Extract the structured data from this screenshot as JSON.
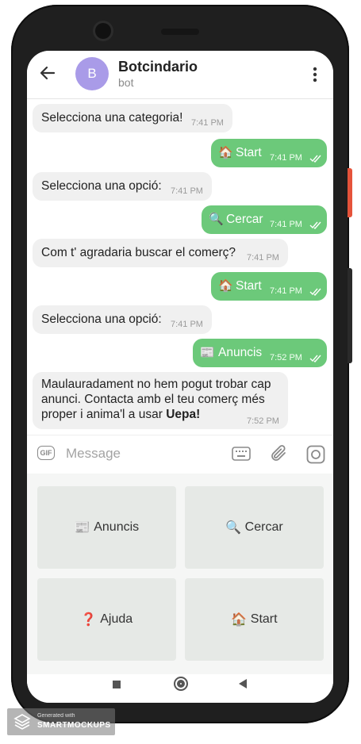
{
  "header": {
    "back_icon": "arrow-left-icon",
    "avatar_letter": "B",
    "avatar_color": "#a99be8",
    "title": "Botcindario",
    "subtitle": "bot",
    "menu_icon": "more-vertical-icon"
  },
  "messages": [
    {
      "dir": "in",
      "text": "Selecciona una categoria!",
      "time": "7:41 PM"
    },
    {
      "dir": "out",
      "emoji": "🏠",
      "text": "Start",
      "time": "7:41 PM"
    },
    {
      "dir": "in",
      "text": "Selecciona una opció:",
      "time": "7:41 PM"
    },
    {
      "dir": "out",
      "emoji": "🔍",
      "text": "Cercar",
      "time": "7:41 PM"
    },
    {
      "dir": "in",
      "text": "Com t' agradaria buscar el comerç?",
      "time": "7:41 PM"
    },
    {
      "dir": "out",
      "emoji": "🏠",
      "text": "Start",
      "time": "7:41 PM"
    },
    {
      "dir": "in",
      "text": "Selecciona una opció:",
      "time": "7:41 PM"
    },
    {
      "dir": "out",
      "emoji": "📰",
      "text": "Anuncis",
      "time": "7:52 PM"
    },
    {
      "dir": "in",
      "line1": "Maulauradament no hem pogut trobar cap",
      "line2": "anunci. Contacta amb el teu comerç més",
      "line3_pre": "proper i anima'l a usar ",
      "line3_bold": "Uepa!",
      "time": "7:52 PM"
    }
  ],
  "input": {
    "gif_label": "GIF",
    "placeholder": "Message"
  },
  "keyboard": {
    "buttons": [
      {
        "emoji": "📰",
        "label": "Anuncis"
      },
      {
        "emoji": "🔍",
        "label": "Cercar"
      },
      {
        "emoji": "❓",
        "label": "Ajuda"
      },
      {
        "emoji": "🏠",
        "label": "Start"
      }
    ]
  },
  "watermark": {
    "small": "Generated with",
    "big": "SMARTMOCKUPS"
  },
  "colors": {
    "outgoing_bubble": "#6cc97a",
    "incoming_bubble": "#f0f0f0",
    "keyboard_button": "#e6e9e6",
    "frame": "#1f1f1f",
    "side_button": "#e5533a"
  }
}
